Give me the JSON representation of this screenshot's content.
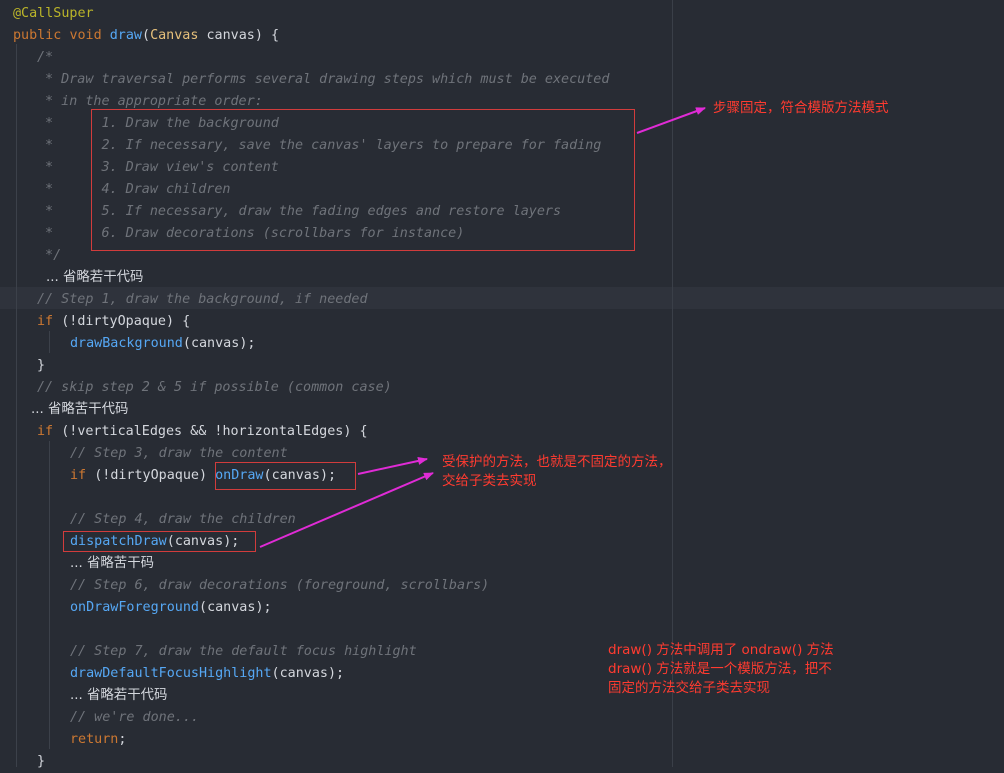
{
  "code": {
    "lines": [
      [
        [
          "ann",
          "@CallSuper"
        ]
      ],
      [
        [
          "kw",
          "public "
        ],
        [
          "kw",
          "void "
        ],
        [
          "fn",
          "draw"
        ],
        [
          "pn",
          "("
        ],
        [
          "ty",
          "Canvas "
        ],
        [
          "id",
          "canvas"
        ],
        [
          "pn",
          ") {"
        ]
      ],
      [
        [
          "cm",
          "/*"
        ]
      ],
      [
        [
          "cm",
          " * Draw traversal performs several drawing steps which must be executed"
        ]
      ],
      [
        [
          "cm",
          " * in the appropriate order:"
        ]
      ],
      [
        [
          "cm",
          " *      1. Draw the background"
        ]
      ],
      [
        [
          "cm",
          " *      2. If necessary, save the canvas' layers to prepare for fading"
        ]
      ],
      [
        [
          "cm",
          " *      3. Draw view's content"
        ]
      ],
      [
        [
          "cm",
          " *      4. Draw children"
        ]
      ],
      [
        [
          "cm",
          " *      5. If necessary, draw the fading edges and restore layers"
        ]
      ],
      [
        [
          "cm",
          " *      6. Draw decorations (scrollbars for instance)"
        ]
      ],
      [
        [
          "cm",
          " */"
        ]
      ],
      [
        [
          "nt",
          "... 省略若干代码"
        ]
      ],
      [
        [
          "cm",
          "// Step 1, draw the background, if needed"
        ]
      ],
      [
        [
          "kw",
          "if "
        ],
        [
          "pn",
          "(!"
        ],
        [
          "id",
          "dirtyOpaque"
        ],
        [
          "pn",
          ") {"
        ]
      ],
      [
        [
          "fn",
          "drawBackground"
        ],
        [
          "pn",
          "("
        ],
        [
          "id",
          "canvas"
        ],
        [
          "pn",
          ");"
        ]
      ],
      [
        [
          "pn",
          "}"
        ]
      ],
      [
        [
          "cm",
          "// skip step 2 & 5 if possible (common case)"
        ]
      ],
      [
        [
          "nt",
          "... 省略苦干代码"
        ]
      ],
      [
        [
          "kw",
          "if "
        ],
        [
          "pn",
          "(!"
        ],
        [
          "id",
          "verticalEdges"
        ],
        [
          "pn",
          " && !"
        ],
        [
          "id",
          "horizontalEdges"
        ],
        [
          "pn",
          ") {"
        ]
      ],
      [
        [
          "cm",
          "// Step 3, draw the content"
        ]
      ],
      [
        [
          "kw",
          "if "
        ],
        [
          "pn",
          "(!"
        ],
        [
          "id",
          "dirtyOpaque"
        ],
        [
          "pn",
          ") "
        ],
        [
          "fn",
          "onDraw"
        ],
        [
          "pn",
          "("
        ],
        [
          "id",
          "canvas"
        ],
        [
          "pn",
          ");"
        ]
      ],
      [],
      [
        [
          "cm",
          "// Step 4, draw the children"
        ]
      ],
      [
        [
          "fn",
          "dispatchDraw"
        ],
        [
          "pn",
          "("
        ],
        [
          "id",
          "canvas"
        ],
        [
          "pn",
          ");"
        ]
      ],
      [
        [
          "nt",
          "... 省略苦干码"
        ]
      ],
      [
        [
          "cm",
          "// Step 6, draw decorations (foreground, scrollbars)"
        ]
      ],
      [
        [
          "fn",
          "onDrawForeground"
        ],
        [
          "pn",
          "("
        ],
        [
          "id",
          "canvas"
        ],
        [
          "pn",
          ");"
        ]
      ],
      [],
      [
        [
          "cm",
          "// Step 7, draw the default focus highlight"
        ]
      ],
      [
        [
          "fn",
          "drawDefaultFocusHighlight"
        ],
        [
          "pn",
          "("
        ],
        [
          "id",
          "canvas"
        ],
        [
          "pn",
          ");"
        ]
      ],
      [
        [
          "nt",
          "... 省略若干代码"
        ]
      ],
      [
        [
          "cm",
          "// we're done..."
        ]
      ],
      [
        [
          "kw",
          "return"
        ],
        [
          "pn",
          ";"
        ]
      ],
      [
        [
          "pn",
          "}"
        ]
      ]
    ]
  },
  "annotations": {
    "steps_note": "步骤固定，符合模版方法模式",
    "protected_note_line1": "受保护的方法，也就是不固定的方法，",
    "protected_note_line2": "交给子类去实现",
    "summary_line1": "draw() 方法中调用了 ondraw() 方法",
    "summary_line2": "draw() 方法就是一个模版方法，把不",
    "summary_line3": "固定的方法交给子类去实现"
  },
  "colors": {
    "background": "#282c34",
    "keyword": "#cc7832",
    "annotation": "#bbb529",
    "function": "#56a8f5",
    "type": "#e6c07b",
    "comment": "#6f737a",
    "highlight_box": "#d13c3c",
    "note_text": "#ff3b30",
    "arrow": "#e02bd6"
  }
}
